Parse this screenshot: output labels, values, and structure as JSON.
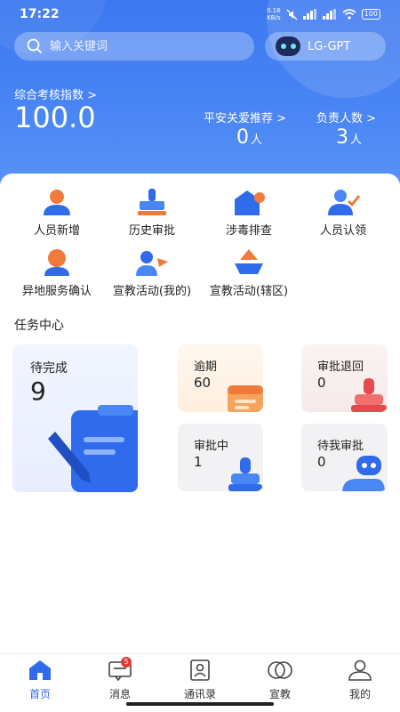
{
  "status_bar": {
    "time": "17:22",
    "net_speed_value": "0.16",
    "net_speed_unit": "KB/s",
    "battery": "100"
  },
  "search": {
    "placeholder": "输入关键词"
  },
  "gpt_button": {
    "label": "LG-GPT"
  },
  "stats": {
    "score_label": "综合考核指数 >",
    "score_value": "100.0",
    "care_label": "平安关爱推荐 >",
    "care_value": "0",
    "care_unit": "人",
    "responsible_label": "负责人数 >",
    "responsible_value": "3",
    "responsible_unit": "人"
  },
  "quick_actions": [
    {
      "label": "人员新增",
      "icon": "person-add-icon"
    },
    {
      "label": "历史审批",
      "icon": "stamp-icon"
    },
    {
      "label": "涉毒排查",
      "icon": "house-search-icon"
    },
    {
      "label": "人员认领",
      "icon": "person-check-icon"
    },
    {
      "label": "异地服务确认",
      "icon": "person-location-icon"
    },
    {
      "label": "宣教活动(我的)",
      "icon": "people-flag-icon"
    },
    {
      "label": "宣教活动(辖区)",
      "icon": "boat-flag-icon"
    }
  ],
  "task_center": {
    "title": "任务中心",
    "pending_complete": {
      "label": "待完成",
      "count": "9"
    },
    "overdue": {
      "label": "逾期",
      "count": "60"
    },
    "returned": {
      "label": "审批退回",
      "count": "0"
    },
    "in_approval": {
      "label": "审批中",
      "count": "1"
    },
    "my_approval": {
      "label": "待我审批",
      "count": "0"
    }
  },
  "bottom_nav": [
    {
      "label": "首页",
      "icon": "home-icon",
      "active": true
    },
    {
      "label": "消息",
      "icon": "message-icon",
      "badge": "5"
    },
    {
      "label": "通讯录",
      "icon": "contacts-icon"
    },
    {
      "label": "宣教",
      "icon": "education-icon"
    },
    {
      "label": "我的",
      "icon": "profile-icon"
    }
  ],
  "colors": {
    "primary": "#2f6bea",
    "header_gradient_top": "#3c78f0",
    "accent_orange": "#f07a3a",
    "badge_red": "#e53935"
  }
}
